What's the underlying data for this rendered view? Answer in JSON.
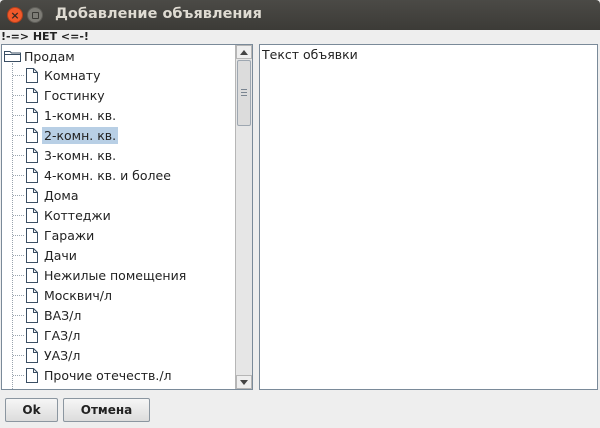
{
  "window": {
    "title": "Добавление объявления",
    "close_icon": "close-icon",
    "minimize_icon": "minimize-icon"
  },
  "status_text": "!-=> НЕТ <=-!",
  "tree": {
    "root_label": "Продам",
    "selected_index": 3,
    "items": [
      "Комнату",
      "Гостинку",
      "1-комн. кв.",
      "2-комн. кв.",
      "3-комн. кв.",
      "4-комн. кв. и более",
      "Дома",
      "Коттеджи",
      "Гаражи",
      "Дачи",
      "Нежилые помещения",
      "Москвич/л",
      "ВАЗ/л",
      "ГАЗ/л",
      "УАЗ/л",
      "Прочие отечеств./л"
    ]
  },
  "ad_text": "Текст объявки",
  "buttons": {
    "ok": "Ok",
    "cancel": "Отмена"
  },
  "colors": {
    "selection": "#b8cfe5",
    "titlebar": "#3c3b37",
    "close_button": "#f1592a"
  }
}
